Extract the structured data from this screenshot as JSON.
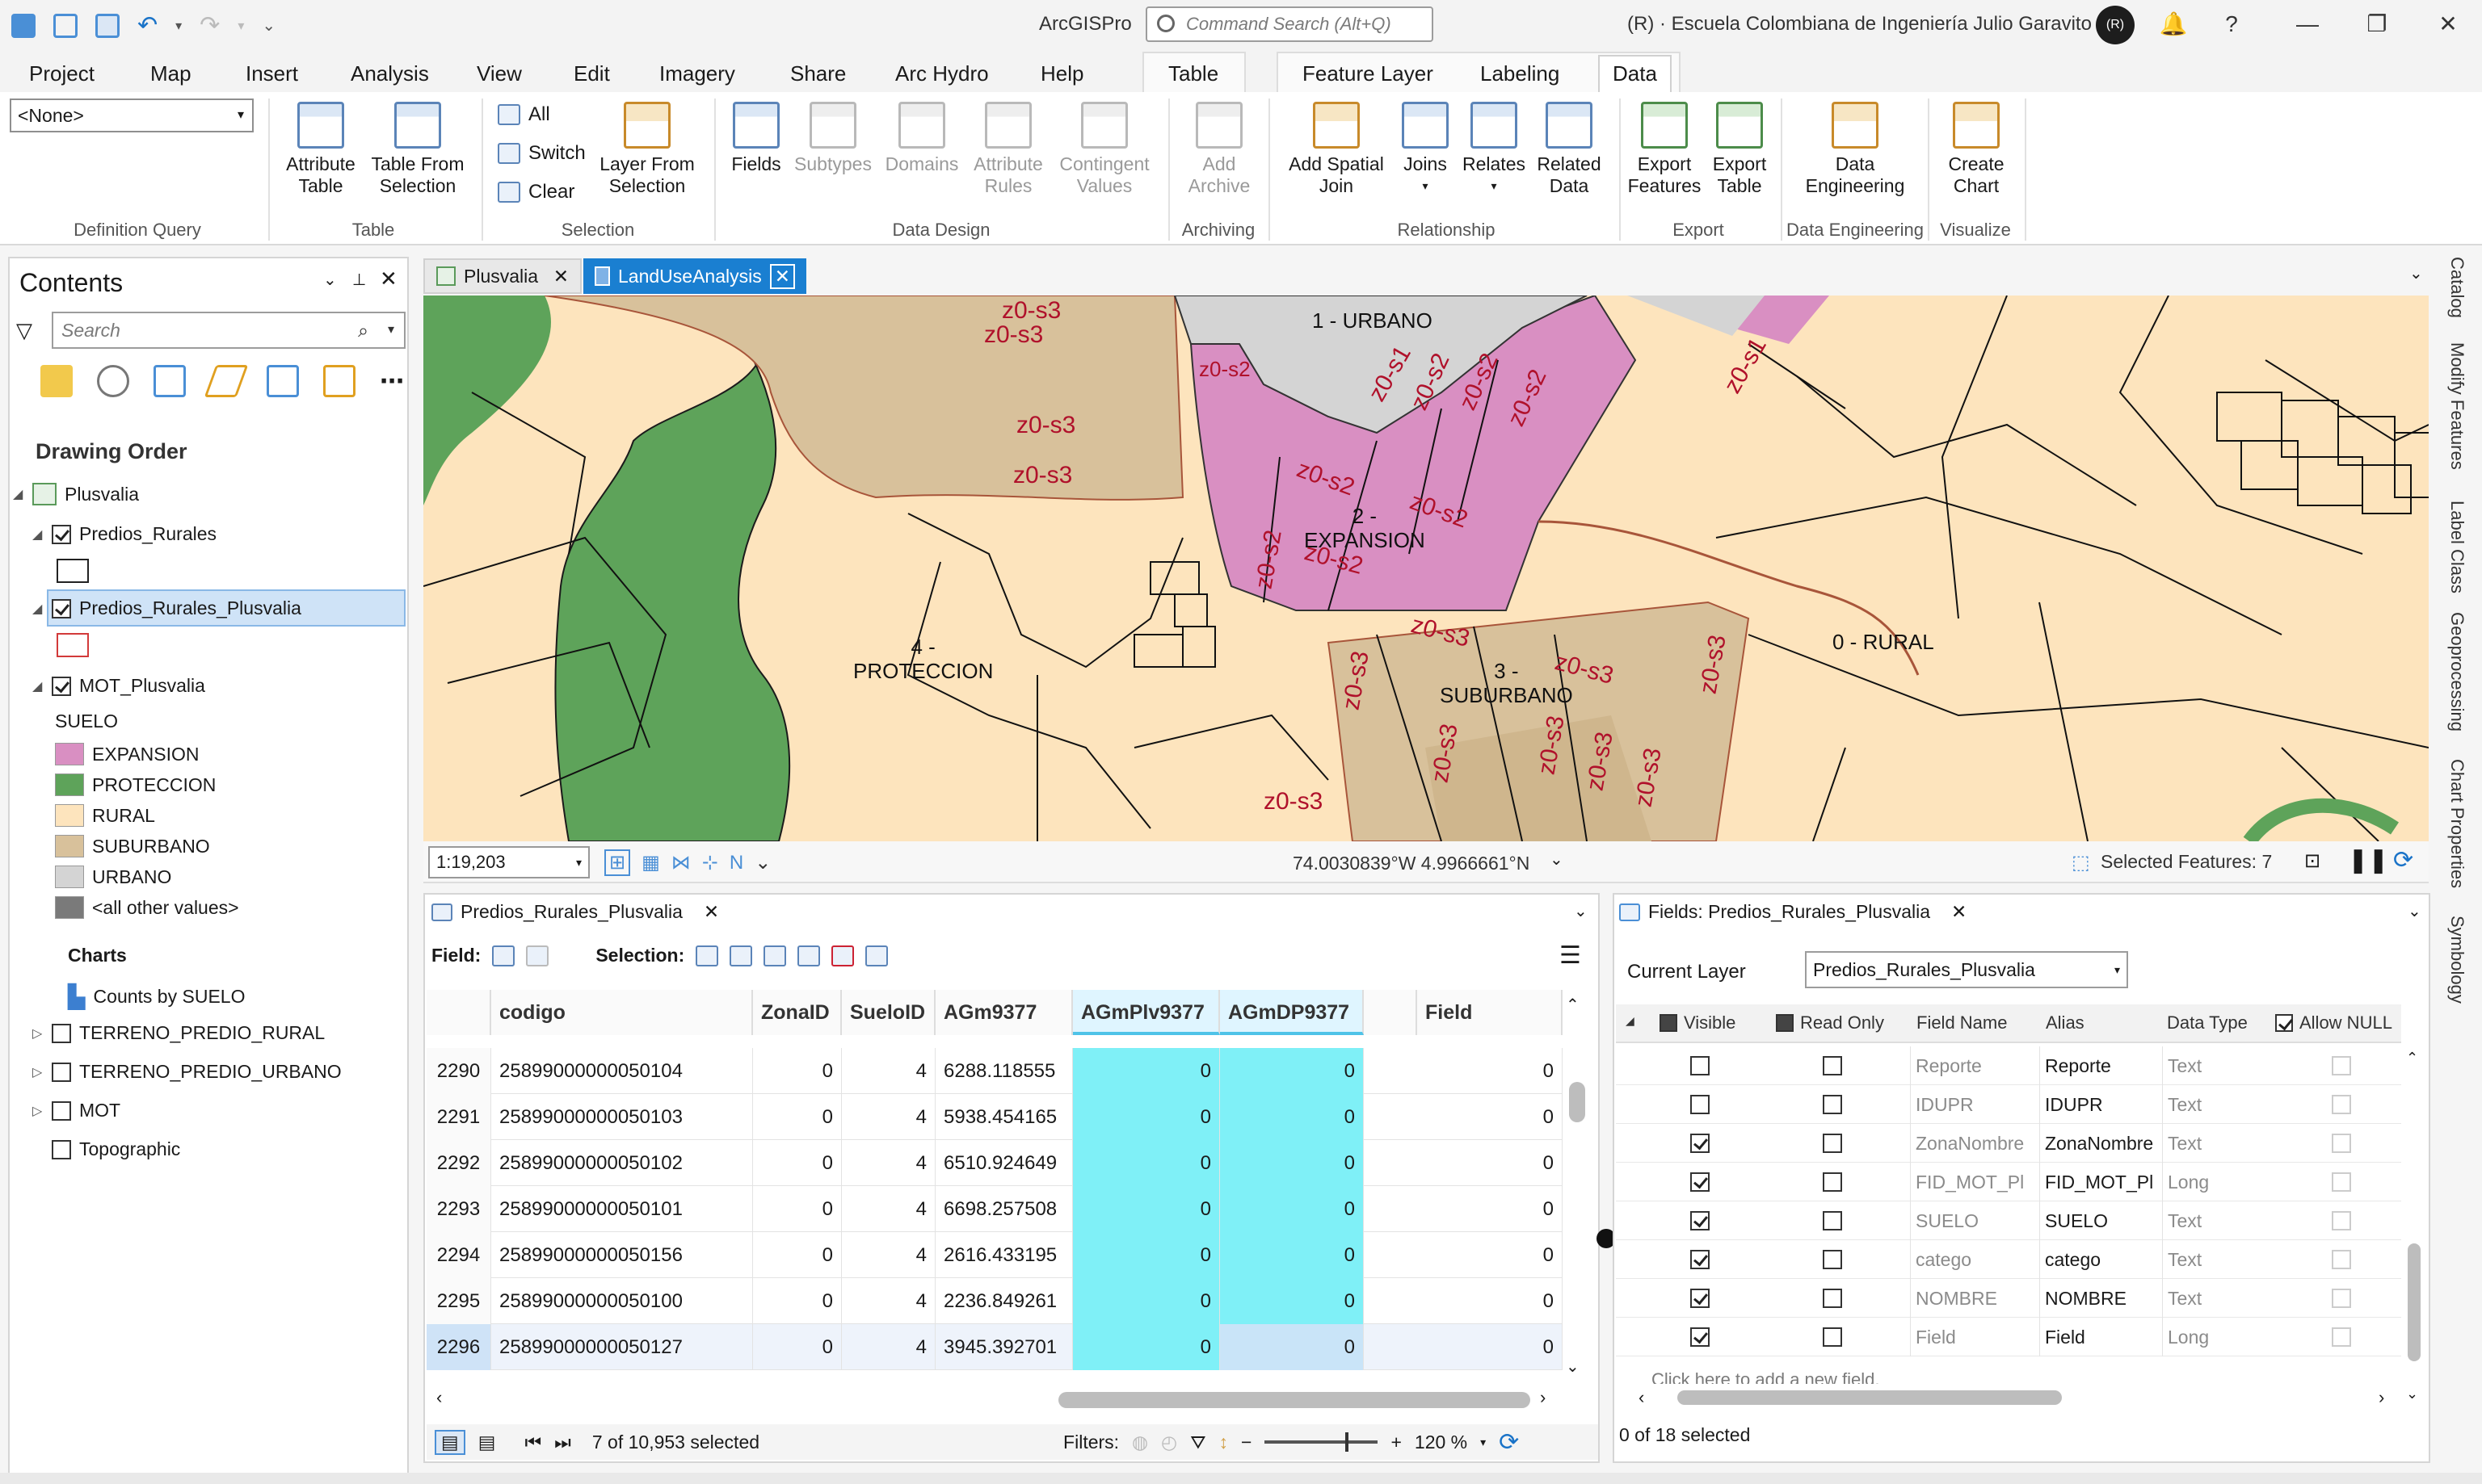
{
  "app": {
    "title": "ArcGISPro",
    "command_search_placeholder": "Command Search (Alt+Q)",
    "org": "(R) · Escuela Colombiana de Ingeniería Julio Garavito",
    "avatar_initials": "(R)"
  },
  "menu": {
    "tabs": [
      "Project",
      "Map",
      "Insert",
      "Analysis",
      "View",
      "Edit",
      "Imagery",
      "Share",
      "Arc Hydro",
      "Help"
    ],
    "contextual_table": "Table",
    "contextual_feature_layer": [
      "Feature Layer",
      "Labeling",
      "Data"
    ],
    "active_tab": "Data"
  },
  "ribbon": {
    "definition_query_value": "<None>",
    "groups": {
      "definition_query": "Definition Query",
      "table": "Table",
      "selection": "Selection",
      "data_design": "Data Design",
      "archiving": "Archiving",
      "relationship": "Relationship",
      "export": "Export",
      "data_engineering": "Data Engineering",
      "visualize": "Visualize"
    },
    "buttons": {
      "attribute_table": "Attribute\nTable",
      "table_from_selection": "Table From\nSelection",
      "all": "All",
      "switch": "Switch",
      "clear": "Clear",
      "layer_from_selection": "Layer From\nSelection",
      "fields": "Fields",
      "subtypes": "Subtypes",
      "domains": "Domains",
      "attribute_rules": "Attribute\nRules",
      "contingent_values": "Contingent\nValues",
      "add_archive": "Add\nArchive",
      "add_spatial_join": "Add Spatial\nJoin",
      "joins": "Joins",
      "relates": "Relates",
      "related_data": "Related\nData",
      "export_features": "Export\nFeatures",
      "export_table": "Export\nTable",
      "data_engineering": "Data\nEngineering",
      "create_chart": "Create\nChart"
    }
  },
  "contents": {
    "title": "Contents",
    "search_placeholder": "Search",
    "drawing_order": "Drawing Order",
    "map_name": "Plusvalia",
    "layers": {
      "predios_rurales": "Predios_Rurales",
      "predios_rurales_plusvalia": "Predios_Rurales_Plusvalia",
      "mot_plusvalia": "MOT_Plusvalia",
      "suelo_heading": "SUELO",
      "legend": [
        {
          "label": "EXPANSION",
          "color": "#d98fc2"
        },
        {
          "label": "PROTECCION",
          "color": "#5ea35a"
        },
        {
          "label": "RURAL",
          "color": "#fde4bd"
        },
        {
          "label": "SUBURBANO",
          "color": "#d8c19b"
        },
        {
          "label": "URBANO",
          "color": "#d4d4d4"
        },
        {
          "label": "<all other values>",
          "color": "#7a7a7a"
        }
      ],
      "charts_heading": "Charts",
      "chart_item": "Counts by SUELO",
      "terreno_rural": "TERRENO_PREDIO_RURAL",
      "terreno_urbano": "TERRENO_PREDIO_URBANO",
      "mot": "MOT",
      "topographic": "Topographic"
    }
  },
  "map": {
    "tabs": [
      "Plusvalia",
      "LandUseAnalysis"
    ],
    "labels": {
      "urbano": "1 - URBANO",
      "expansion": "2 -\nEXPANSION",
      "proteccion": "4 -\nPROTECCION",
      "suburbano": "3 -\nSUBURBANO",
      "rural": "0 - RURAL"
    },
    "zone_labels": [
      "z0-s3",
      "z0-s3",
      "z0-s3",
      "z0-s3",
      "z0-s2",
      "z0-s1",
      "z0-s2",
      "z0-s2",
      "z0-s2",
      "z0-s2",
      "z0-s2",
      "z0-s2",
      "z0-s2",
      "z0-s3",
      "z0-s3",
      "z0-s3",
      "z0-s3",
      "z0-s3",
      "z0-s3",
      "z0-s3",
      "z0-s3",
      "z0-s3",
      "z0-s1"
    ],
    "scale": "1:19,203",
    "coordinates": "74.0030839°W 4.9966661°N",
    "selected_features": "Selected Features: 7"
  },
  "attribute_table": {
    "tab": "Predios_Rurales_Plusvalia",
    "field_label": "Field:",
    "selection_label": "Selection:",
    "columns": [
      "codigo",
      "ZonaID",
      "SueloID",
      "AGm9377",
      "AGmPlv9377",
      "AGmDP9377",
      "Field"
    ],
    "rows": [
      {
        "id": "2290",
        "codigo": "25899000000050104",
        "zona": "0",
        "suelo": "4",
        "agm": "6288.118555",
        "plv": "0",
        "dp": "0",
        "field": "0"
      },
      {
        "id": "2291",
        "codigo": "25899000000050103",
        "zona": "0",
        "suelo": "4",
        "agm": "5938.454165",
        "plv": "0",
        "dp": "0",
        "field": "0"
      },
      {
        "id": "2292",
        "codigo": "25899000000050102",
        "zona": "0",
        "suelo": "4",
        "agm": "6510.924649",
        "plv": "0",
        "dp": "0",
        "field": "0"
      },
      {
        "id": "2293",
        "codigo": "25899000000050101",
        "zona": "0",
        "suelo": "4",
        "agm": "6698.257508",
        "plv": "0",
        "dp": "0",
        "field": "0"
      },
      {
        "id": "2294",
        "codigo": "25899000000050156",
        "zona": "0",
        "suelo": "4",
        "agm": "2616.433195",
        "plv": "0",
        "dp": "0",
        "field": "0"
      },
      {
        "id": "2295",
        "codigo": "25899000000050100",
        "zona": "0",
        "suelo": "4",
        "agm": "2236.849261",
        "plv": "0",
        "dp": "0",
        "field": "0"
      },
      {
        "id": "2296",
        "codigo": "25899000000050127",
        "zona": "0",
        "suelo": "4",
        "agm": "3945.392701",
        "plv": "0",
        "dp": "0",
        "field": "0"
      }
    ],
    "status": "7 of 10,953 selected",
    "filters_label": "Filters:",
    "zoom": "120 %"
  },
  "fields_view": {
    "tab": "Fields: Predios_Rurales_Plusvalia",
    "current_layer_label": "Current Layer",
    "current_layer_value": "Predios_Rurales_Plusvalia",
    "columns": [
      "Visible",
      "Read Only",
      "Field Name",
      "Alias",
      "Data Type",
      "Allow NULL"
    ],
    "rows": [
      {
        "visible": false,
        "name": "Reporte",
        "alias": "Reporte",
        "type": "Text"
      },
      {
        "visible": false,
        "name": "IDUPR",
        "alias": "IDUPR",
        "type": "Text"
      },
      {
        "visible": true,
        "name": "ZonaNombre",
        "alias": "ZonaNombre",
        "type": "Text"
      },
      {
        "visible": true,
        "name": "FID_MOT_Pl",
        "alias": "FID_MOT_Pl",
        "type": "Long"
      },
      {
        "visible": true,
        "name": "SUELO",
        "alias": "SUELO",
        "type": "Text"
      },
      {
        "visible": true,
        "name": "catego",
        "alias": "catego",
        "type": "Text"
      },
      {
        "visible": true,
        "name": "NOMBRE",
        "alias": "NOMBRE",
        "type": "Text"
      },
      {
        "visible": true,
        "name": "Field",
        "alias": "Field",
        "type": "Long"
      }
    ],
    "add_field_hint": "Click here to add a new field.",
    "status": "0 of 18 selected"
  },
  "dock": [
    "Catalog",
    "Modify Features",
    "Label Class",
    "Geoprocessing",
    "Chart Properties",
    "Symbology"
  ]
}
